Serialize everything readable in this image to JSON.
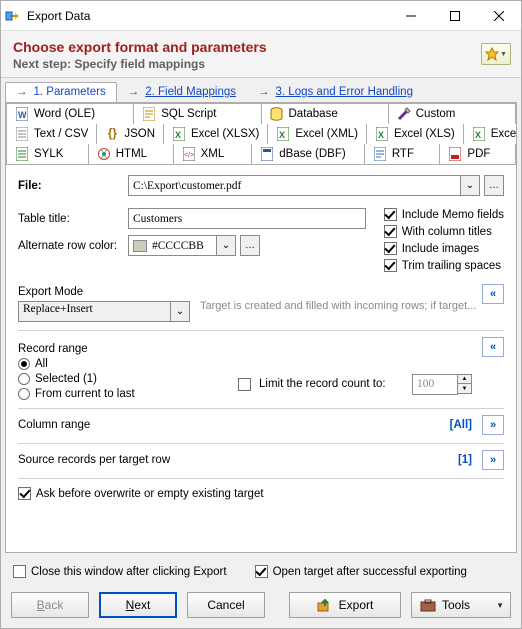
{
  "window": {
    "title": "Export Data"
  },
  "header": {
    "title": "Choose export format and parameters",
    "subtitle": "Next step: Specify field mappings"
  },
  "wizard": {
    "tabs": [
      {
        "label": "1. Parameters",
        "active": true
      },
      {
        "label": "2. Field Mappings",
        "active": false
      },
      {
        "label": "3. Logs and Error Handling",
        "active": false
      }
    ]
  },
  "formats": {
    "row1": [
      {
        "label": "Word (OLE)",
        "icon": "word"
      },
      {
        "label": "SQL Script",
        "icon": "sql"
      },
      {
        "label": "Database",
        "icon": "db"
      },
      {
        "label": "Custom",
        "icon": "custom"
      }
    ],
    "row2": [
      {
        "label": "Text / CSV",
        "icon": "txt"
      },
      {
        "label": "JSON",
        "icon": "json"
      },
      {
        "label": "Excel (XLSX)",
        "icon": "xlsx"
      },
      {
        "label": "Excel (XML)",
        "icon": "xml"
      },
      {
        "label": "Excel (XLS)",
        "icon": "xls"
      },
      {
        "label": "Excel (OLE)",
        "icon": "xlso"
      }
    ],
    "row3": [
      {
        "label": "SYLK",
        "icon": "sylk"
      },
      {
        "label": "HTML",
        "icon": "html"
      },
      {
        "label": "XML",
        "icon": "xmlg"
      },
      {
        "label": "dBase (DBF)",
        "icon": "dbf"
      },
      {
        "label": "RTF",
        "icon": "rtf"
      },
      {
        "label": "PDF",
        "icon": "pdf",
        "active": true
      }
    ]
  },
  "form": {
    "file_label": "File:",
    "file_value": "C:\\Export\\customer.pdf",
    "title_label": "Table title:",
    "title_value": "Customers",
    "altcolor_label": "Alternate row color:",
    "altcolor_value": "#CCCCBB",
    "checks": {
      "memo": "Include Memo fields",
      "coltitles": "With column titles",
      "images": "Include images",
      "trim": "Trim trailing spaces"
    },
    "export_mode_label": "Export Mode",
    "export_mode_value": "Replace+Insert",
    "export_mode_hint": "Target is created and filled with incoming rows; if target...",
    "record_range_label": "Record range",
    "range_all": "All",
    "range_sel": "Selected (1)",
    "range_from": "From current to last",
    "limit_label": "Limit the record count to:",
    "limit_value": "100",
    "column_range_label": "Column range",
    "column_range_value": "[All]",
    "src_per_row_label": "Source records per target row",
    "src_per_row_value": "[1]",
    "ask_overwrite": "Ask before overwrite or empty existing target"
  },
  "footer": {
    "close_after": "Close this window after clicking Export",
    "open_after": "Open target after successful exporting",
    "back": "Back",
    "next": "Next",
    "cancel": "Cancel",
    "export": "Export",
    "tools": "Tools"
  }
}
